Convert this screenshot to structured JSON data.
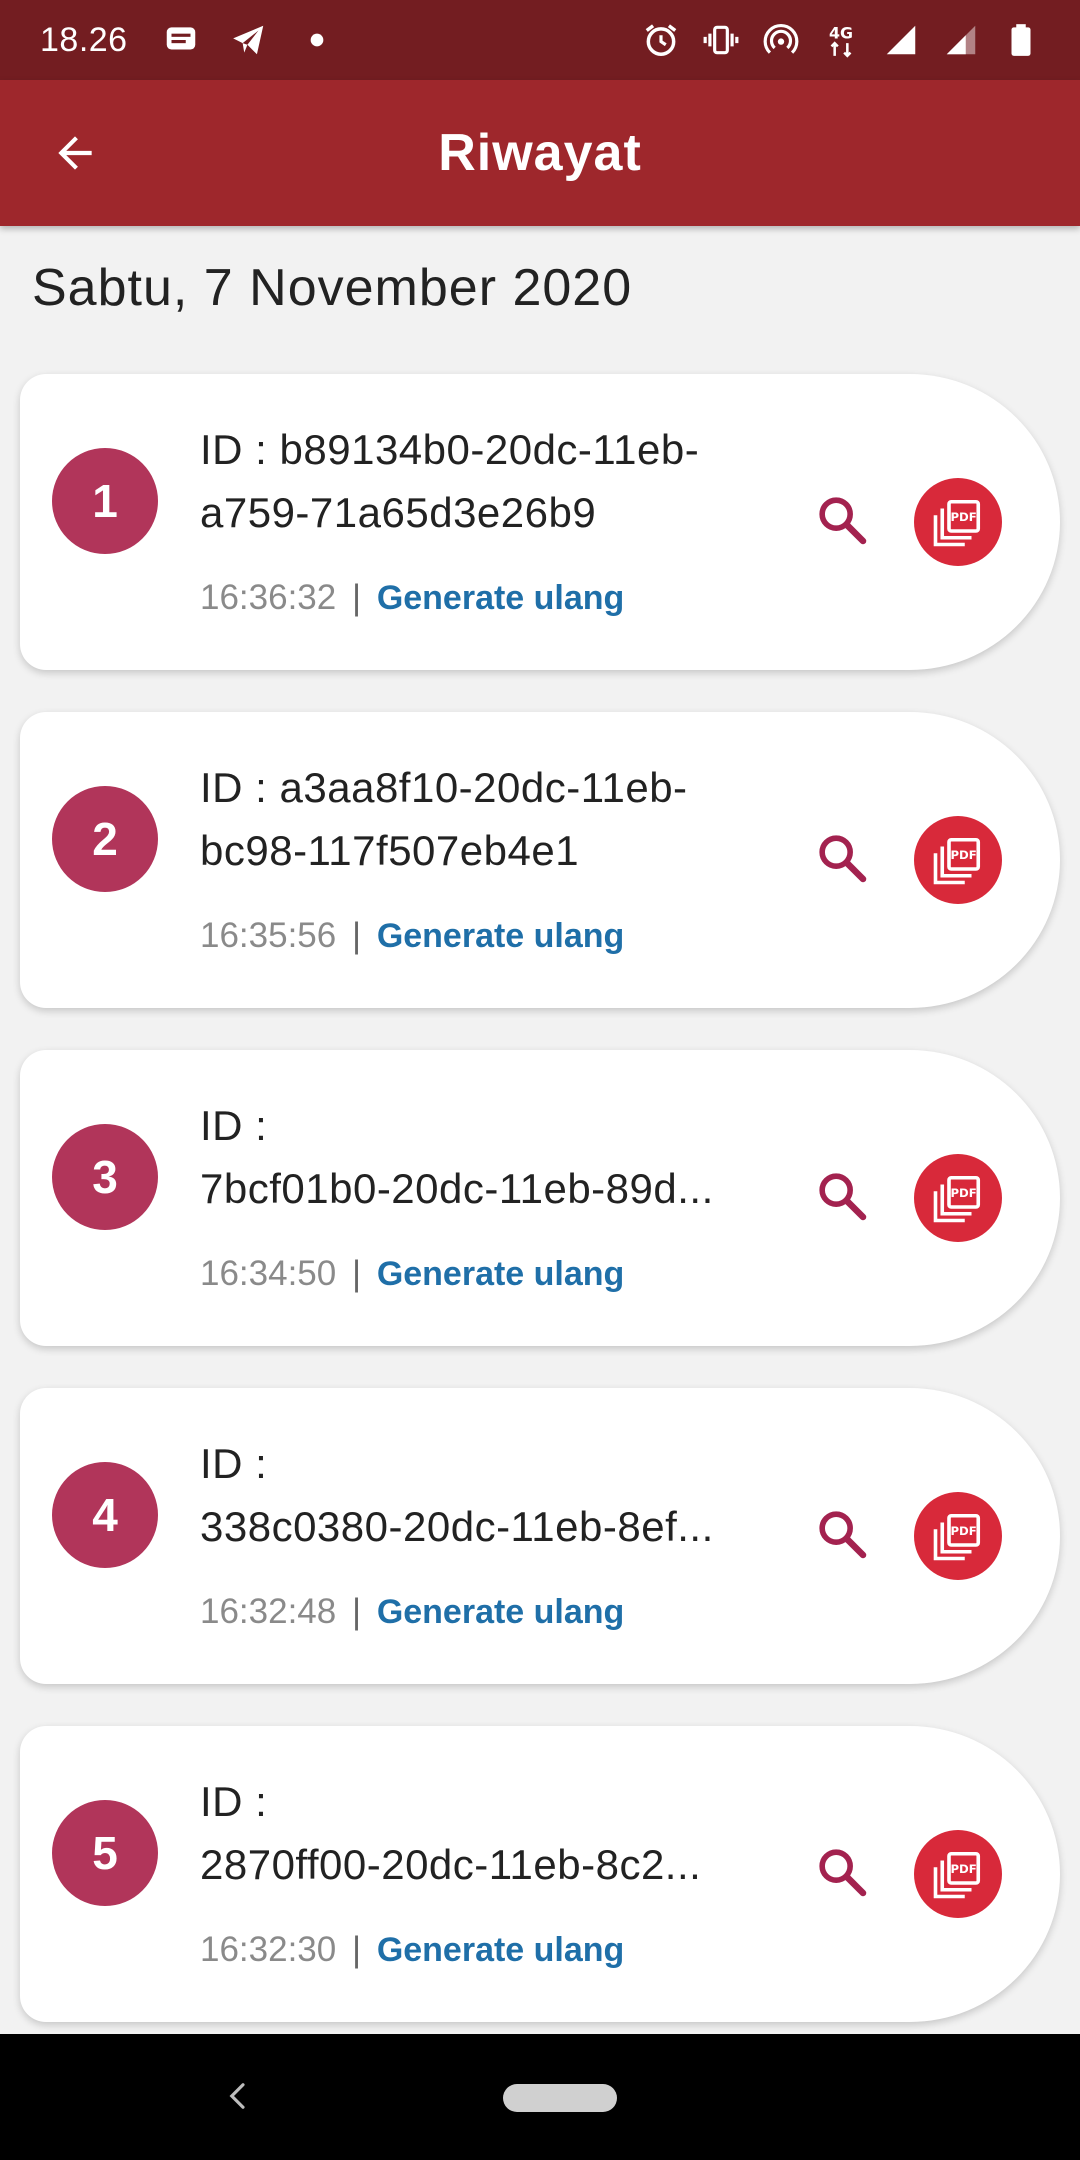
{
  "status_bar": {
    "time": "18.26",
    "network_label": "4G",
    "left_icons": [
      "message-icon",
      "telegram-icon",
      "dot-icon"
    ],
    "right_icons": [
      "alarm-icon",
      "vibrate-icon",
      "hotspot-icon",
      "network-4g-icon",
      "signal-icon",
      "signal-icon",
      "battery-icon"
    ]
  },
  "app_bar": {
    "title": "Riwayat",
    "back_icon": "arrow-back-icon"
  },
  "date_header": "Sabtu, 7 November 2020",
  "items": [
    {
      "number": "1",
      "id_line1": "ID : b89134b0-20dc-11eb-",
      "id_line2": "a759-71a65d3e26b9",
      "time": "16:36:32",
      "separator": "|",
      "action": "Generate ulang"
    },
    {
      "number": "2",
      "id_line1": "ID : a3aa8f10-20dc-11eb-",
      "id_line2": "bc98-117f507eb4e1",
      "time": "16:35:56",
      "separator": "|",
      "action": "Generate ulang"
    },
    {
      "number": "3",
      "id_line1": "ID :",
      "id_line2": "7bcf01b0-20dc-11eb-89d...",
      "time": "16:34:50",
      "separator": "|",
      "action": "Generate ulang"
    },
    {
      "number": "4",
      "id_line1": "ID :",
      "id_line2": "338c0380-20dc-11eb-8ef...",
      "time": "16:32:48",
      "separator": "|",
      "action": "Generate ulang"
    },
    {
      "number": "5",
      "id_line1": "ID :",
      "id_line2": "2870ff00-20dc-11eb-8c2...",
      "time": "16:32:30",
      "separator": "|",
      "action": "Generate ulang"
    }
  ],
  "colors": {
    "status_bar": "#731d21",
    "app_bar": "#9e272c",
    "badge": "#b1355a",
    "pdf_button": "#d8293a",
    "link": "#1f6fa8",
    "search_icon": "#a3224f"
  }
}
